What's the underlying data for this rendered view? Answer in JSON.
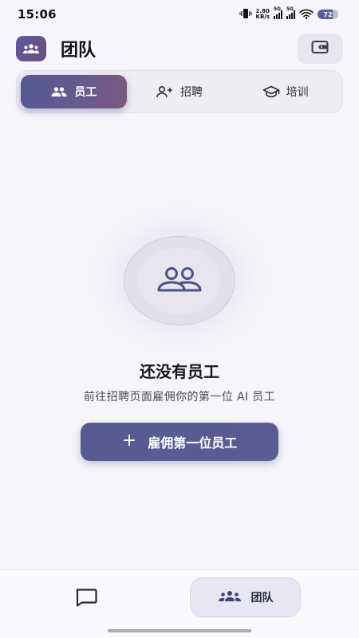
{
  "status_bar": {
    "time": "15:06",
    "net_speed_value": "2.80",
    "net_speed_unit": "KB/s",
    "signal1_label": "5G",
    "signal2_label": "5G",
    "battery": "72",
    "battery_level_percent": 72
  },
  "header": {
    "title": "团队",
    "app_icon": "team-icon",
    "wallet_icon": "wallet-icon"
  },
  "tabs": [
    {
      "label": "员工",
      "icon": "people-icon",
      "active": true
    },
    {
      "label": "招聘",
      "icon": "person-add-icon",
      "active": false
    },
    {
      "label": "培训",
      "icon": "graduation-cap-icon",
      "active": false
    }
  ],
  "empty_state": {
    "icon": "people-outline-icon",
    "title": "还没有员工",
    "subtitle": "前往招聘页面雇佣你的第一位 AI 员工",
    "button_label": "雇佣第一位员工",
    "button_icon": "plus"
  },
  "bottom_nav": {
    "chat_icon": "chat-icon",
    "team_label": "团队",
    "team_icon": "team-icon"
  },
  "colors": {
    "accent": "#555b91",
    "background": "#f6f5fb"
  }
}
